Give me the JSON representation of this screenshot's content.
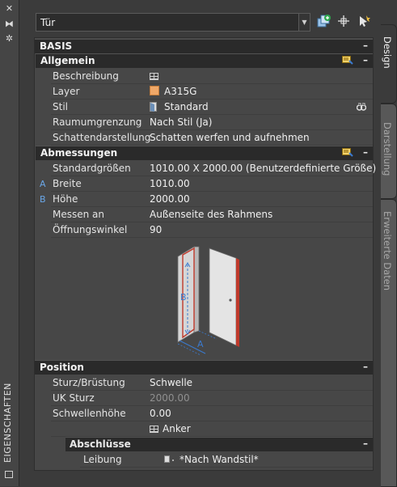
{
  "palette_title": "EIGENSCHAFTEN",
  "object_type": {
    "selected": "Tür"
  },
  "tabs": [
    {
      "label": "Design",
      "active": true
    },
    {
      "label": "Darstellung",
      "active": false
    },
    {
      "label": "Erweiterte Daten",
      "active": false
    }
  ],
  "sections": {
    "basis": {
      "title": "BASIS"
    },
    "allgemein": {
      "title": "Allgemein",
      "rows": [
        {
          "label": "Beschreibung",
          "value": ""
        },
        {
          "label": "Layer",
          "value": "A315G"
        },
        {
          "label": "Stil",
          "value": "Standard"
        },
        {
          "label": "Raumumgrenzung",
          "value": "Nach Stil (Ja)"
        },
        {
          "label": "Schattendarstellung",
          "value": "Schatten werfen und aufnehmen"
        }
      ]
    },
    "abmessungen": {
      "title": "Abmessungen",
      "rows": [
        {
          "label": "Standardgrößen",
          "value": "1010.00  X  2000.00 (Benutzerdefinierte Größe)",
          "marker": ""
        },
        {
          "label": "Breite",
          "value": "1010.00",
          "marker": "A"
        },
        {
          "label": "Höhe",
          "value": "2000.00",
          "marker": "B"
        },
        {
          "label": "Messen an",
          "value": "Außenseite des Rahmens",
          "marker": ""
        },
        {
          "label": "Öffnungswinkel",
          "value": "90",
          "marker": ""
        }
      ],
      "diagram": {
        "label_a": "A",
        "label_b": "B"
      }
    },
    "position": {
      "title": "Position",
      "rows": [
        {
          "label": "Sturz/Brüstung",
          "value": "Schwelle",
          "dim": false
        },
        {
          "label": "UK Sturz",
          "value": "2000.00",
          "dim": true
        },
        {
          "label": "Schwellenhöhe",
          "value": "0.00",
          "dim": false
        }
      ],
      "anchor_label": "Anker"
    },
    "abschluesse": {
      "title": "Abschlüsse",
      "rows": [
        {
          "label": "Leibung",
          "value": "*Nach Wandstil*"
        }
      ]
    }
  },
  "collapse_symbol": "–"
}
